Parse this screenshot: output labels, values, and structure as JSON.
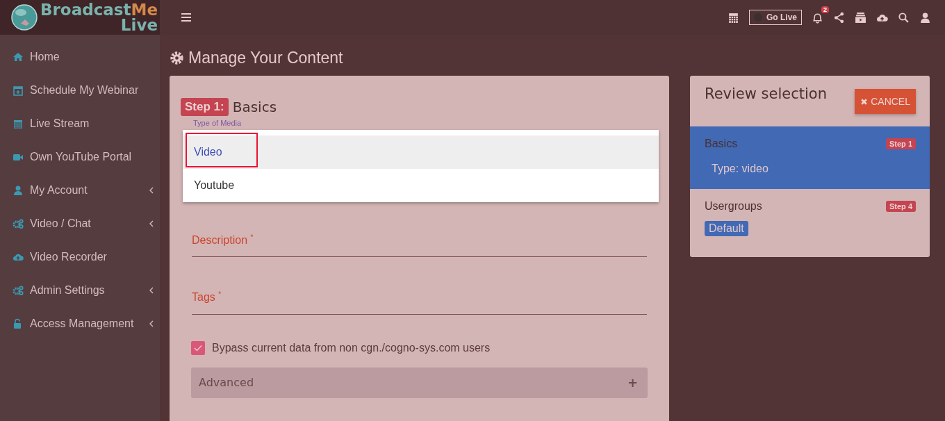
{
  "logo": {
    "word1": "Broadcast",
    "word2": "Me",
    "word3": "Live"
  },
  "topbar": {
    "go_live": "Go Live",
    "live_on": false,
    "notifications": "2"
  },
  "sidebar": {
    "items": [
      {
        "label": "Home",
        "kind": "home",
        "submenu": false
      },
      {
        "label": "Schedule My Webinar",
        "kind": "schedule",
        "submenu": false
      },
      {
        "label": "Live Stream",
        "kind": "calendar",
        "submenu": false
      },
      {
        "label": "Own YouTube Portal",
        "kind": "camera",
        "submenu": false
      },
      {
        "label": "My Account",
        "kind": "user",
        "submenu": true
      },
      {
        "label": "Video / Chat",
        "kind": "gears",
        "submenu": true
      },
      {
        "label": "Video Recorder",
        "kind": "cloud",
        "submenu": false
      },
      {
        "label": "Admin Settings",
        "kind": "gears",
        "submenu": true
      },
      {
        "label": "Access Management",
        "kind": "lock",
        "submenu": true
      }
    ]
  },
  "page_title": "Manage Your Content",
  "form": {
    "step_badge": "Step 1:",
    "step_title": "Basics",
    "media_label": "Type of Media",
    "media_options": [
      {
        "label": "Video",
        "selected": true,
        "annotated": true
      },
      {
        "label": "Youtube",
        "selected": false,
        "annotated": false
      }
    ],
    "fields": [
      {
        "label": "Description",
        "required": true
      },
      {
        "label": "Tags",
        "required": true
      }
    ],
    "required_mark": "*",
    "bypass": {
      "label": "Bypass current data from non cgn./cogno-sys.com users",
      "checked": true
    },
    "advanced": {
      "label": "Advanced",
      "toggle": "+"
    }
  },
  "review": {
    "title": "Review selection",
    "cancel": "CANCEL",
    "sections": [
      {
        "title": "Basics",
        "step": "Step 1",
        "selected": true,
        "value": "Type: video",
        "kind": "text"
      },
      {
        "title": "Usergroups",
        "step": "Step 4",
        "selected": false,
        "value": "Default",
        "kind": "tag"
      }
    ]
  }
}
